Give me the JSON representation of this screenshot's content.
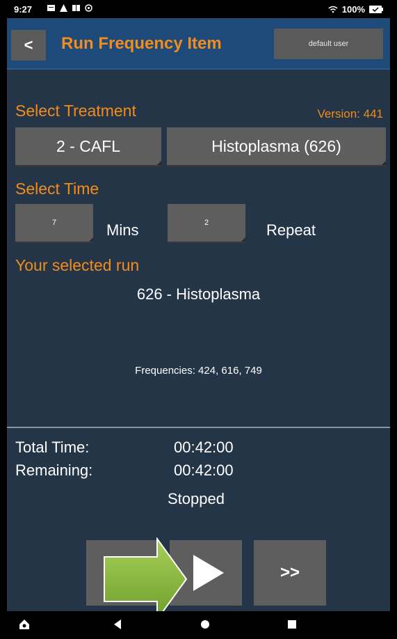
{
  "status_bar": {
    "time": "9:27",
    "battery": "100%",
    "icons": [
      "message-icon",
      "alert-icon",
      "book-icon",
      "settings-icon"
    ]
  },
  "header": {
    "back_label": "<",
    "title": "Run Frequency Item",
    "user_label": "default user"
  },
  "treatment": {
    "label": "Select Treatment",
    "version": "Version: 441",
    "category_button": "2 -  CAFL",
    "item_button": "Histoplasma (626)"
  },
  "time": {
    "label": "Select Time",
    "minutes_value": "7",
    "minutes_label": "Mins",
    "repeat_value": "2",
    "repeat_label": "Repeat"
  },
  "selected_run": {
    "label": "Your selected run",
    "name": "626 -  Histoplasma",
    "frequencies": "Frequencies: 424, 616, 749"
  },
  "timer": {
    "total_label": "Total Time:",
    "total_value": "00:42:00",
    "remaining_label": "Remaining:",
    "remaining_value": "00:42:00",
    "status": "Stopped"
  },
  "controls": {
    "next_label": ">>"
  },
  "colors": {
    "accent": "#f28c1c",
    "background": "#253548",
    "header": "#1e4a7a",
    "button": "#5e5e5e",
    "overlay_arrow": "#8dbf3c"
  }
}
